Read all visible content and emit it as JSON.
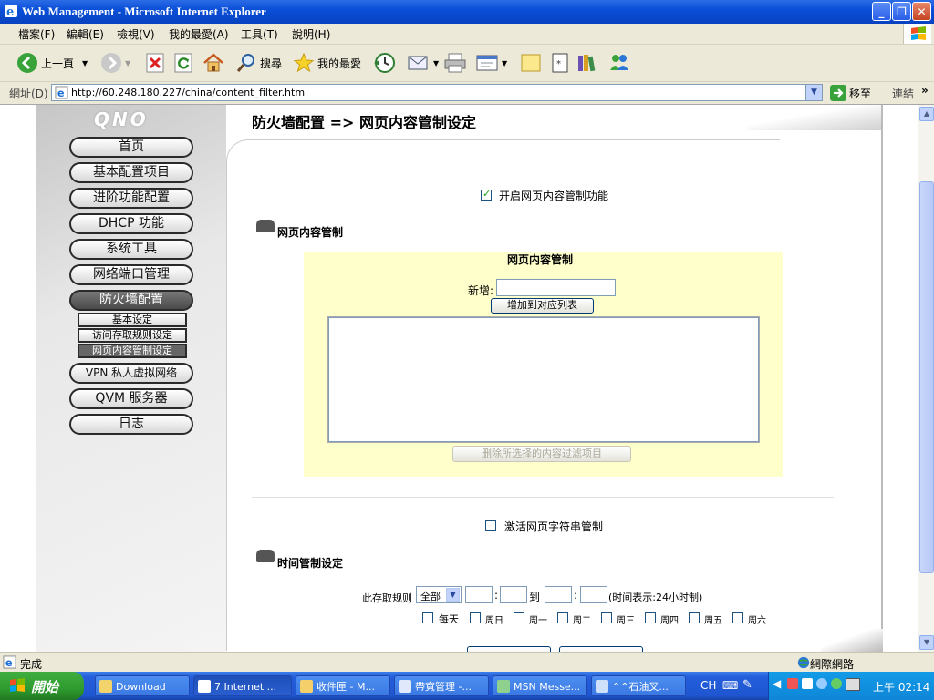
{
  "window": {
    "title": "Web Management - Microsoft Internet Explorer"
  },
  "menu": [
    "檔案(F)",
    "編輯(E)",
    "檢視(V)",
    "我的最愛(A)",
    "工具(T)",
    "說明(H)"
  ],
  "toolbar": {
    "back_label": "上一頁",
    "search_label": "搜尋",
    "favorites_label": "我的最愛"
  },
  "address": {
    "label": "網址(D)",
    "url": "http://60.248.180.227/china/content_filter.htm",
    "go_label": "移至",
    "links_label": "連結"
  },
  "logo_text": "QNO",
  "nav": {
    "items": [
      "首页",
      "基本配置项目",
      "进阶功能配置",
      "DHCP 功能",
      "系统工具",
      "网络端口管理",
      "防火墙配置"
    ],
    "sub_items": [
      "基本设定",
      "访问存取规则设定",
      "网页内容管制设定"
    ],
    "items_after": [
      "VPN 私人虚拟网络",
      "QVM 服务器",
      "日志"
    ]
  },
  "content": {
    "page_title": "防火墙配置  => 网页内容管制设定",
    "enable_checkbox_label": "开启网页内容管制功能",
    "section1_title": "网页内容管制",
    "box_title": "网页内容管制",
    "add_label": "新增:",
    "add_button": "增加到对应列表",
    "delete_button": "删除所选择的内容过滤项目",
    "string_filter_label": "激活网页字符串管制",
    "section2_title": "时间管制设定",
    "rule_label": "此存取规则",
    "rule_select_value": "全部",
    "to_label": "到",
    "colon": ":",
    "time_note": "(时间表示:24小时制)",
    "days": [
      "每天",
      "周日",
      "周一",
      "周二",
      "周三",
      "周四",
      "周五",
      "周六"
    ]
  },
  "status": {
    "text": "完成",
    "zone": "網際網路"
  },
  "taskbar": {
    "start_label": "開始",
    "tasks": [
      "Download",
      "7 Internet ...",
      "收件匣 - M...",
      "帶寬管理 -...",
      "MSN Messe...",
      "^^石油叉..."
    ],
    "lang": "CH",
    "clock": "上午 02:14"
  },
  "colors": {
    "title_bar": "#0a4fd8",
    "box_bg": "#ffffcc",
    "active_nav": "#555555",
    "taskbar": "#245edb",
    "start_button": "#2f9a2f"
  }
}
